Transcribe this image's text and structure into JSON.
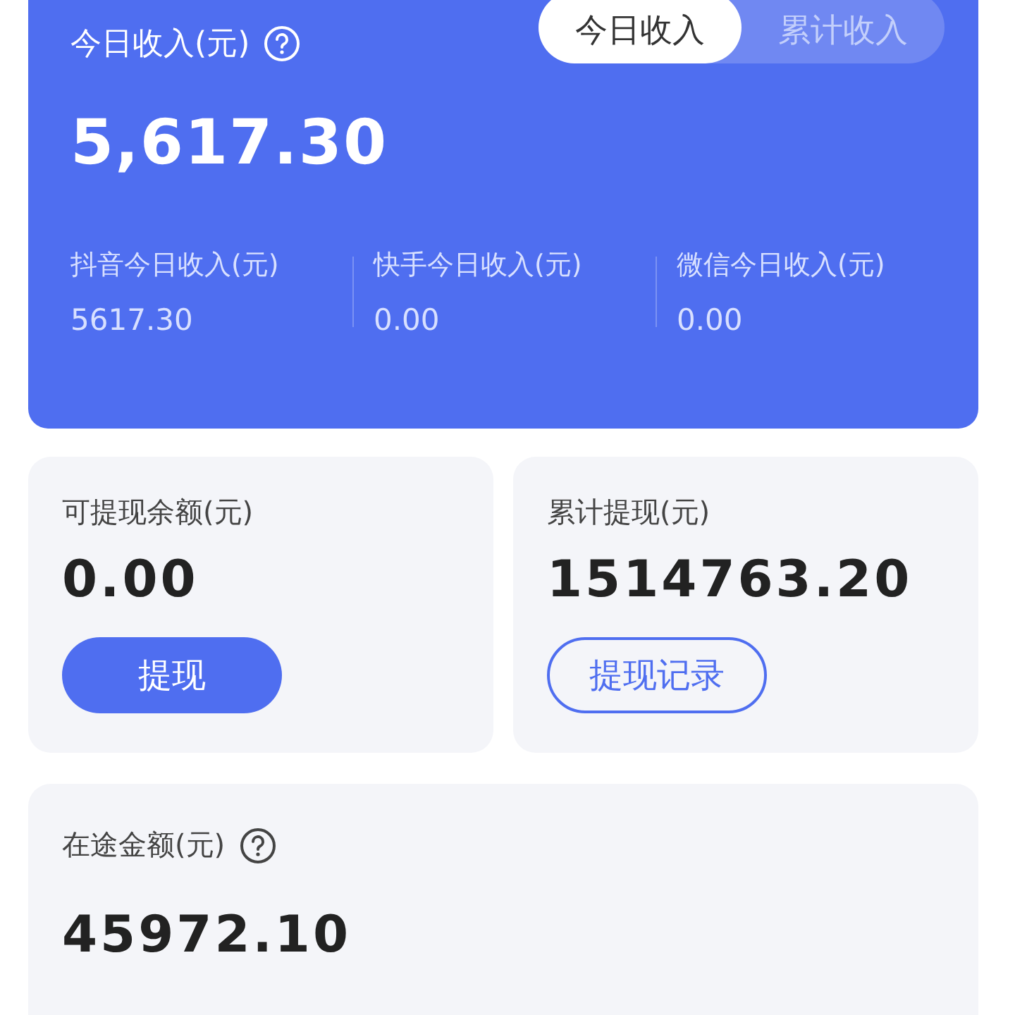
{
  "income_card": {
    "title": "今日收入(元)",
    "amount": "5,617.30",
    "tabs": [
      {
        "label": "今日收入",
        "selected": true
      },
      {
        "label": "累计收入",
        "selected": false
      }
    ],
    "platforms": [
      {
        "label": "抖音今日收入(元)",
        "value": "5617.30"
      },
      {
        "label": "快手今日收入(元)",
        "value": "0.00"
      },
      {
        "label": "微信今日收入(元)",
        "value": "0.00"
      }
    ]
  },
  "withdrawable": {
    "label": "可提现余额(元)",
    "amount": "0.00",
    "button": "提现"
  },
  "total_withdrawn": {
    "label": "累计提现(元)",
    "amount": "1514763.20",
    "button": "提现记录"
  },
  "in_transit": {
    "label": "在途金额(元)",
    "amount": "45972.10"
  }
}
